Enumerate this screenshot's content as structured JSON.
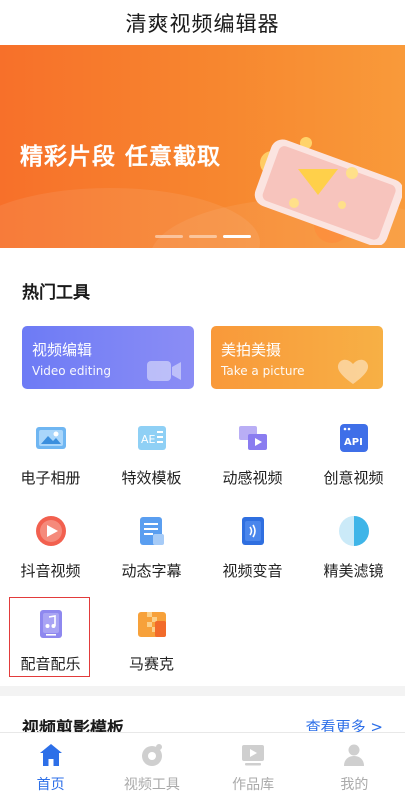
{
  "header": {
    "title": "清爽视频编辑器"
  },
  "banner": {
    "slogan": "精彩片段  任意截取",
    "active_slide": 3,
    "slide_count": 3
  },
  "hot_tools": {
    "title": "热门工具",
    "features": [
      {
        "title": "视频编辑",
        "subtitle": "Video editing",
        "color": "#7580f5",
        "icon": "video-camera-icon"
      },
      {
        "title": "美拍美摄",
        "subtitle": "Take a picture",
        "color": "#f9a13d",
        "icon": "heart-icon"
      }
    ],
    "tools": [
      {
        "label": "电子相册",
        "icon": "photo-album-icon"
      },
      {
        "label": "特效模板",
        "icon": "effect-template-icon"
      },
      {
        "label": "动感视频",
        "icon": "dynamic-video-icon"
      },
      {
        "label": "创意视频",
        "icon": "api-icon"
      },
      {
        "label": "抖音视频",
        "icon": "play-circle-icon"
      },
      {
        "label": "动态字幕",
        "icon": "subtitle-icon"
      },
      {
        "label": "视频变音",
        "icon": "voice-change-icon"
      },
      {
        "label": "精美滤镜",
        "icon": "filter-icon"
      },
      {
        "label": "配音配乐",
        "icon": "music-note-icon"
      },
      {
        "label": "马赛克",
        "icon": "mosaic-icon"
      }
    ]
  },
  "next_section": {
    "title": "视频剪影模板",
    "more": "查看更多 >"
  },
  "tabbar": {
    "items": [
      {
        "label": "首页",
        "icon": "home-icon",
        "active": true
      },
      {
        "label": "视频工具",
        "icon": "video-tools-icon",
        "active": false
      },
      {
        "label": "作品库",
        "icon": "works-library-icon",
        "active": false
      },
      {
        "label": "我的",
        "icon": "user-icon",
        "active": false
      }
    ]
  },
  "colors": {
    "accent": "#2d6fe8",
    "banner": "#f7792d",
    "highlight_border": "#e23b3b"
  }
}
